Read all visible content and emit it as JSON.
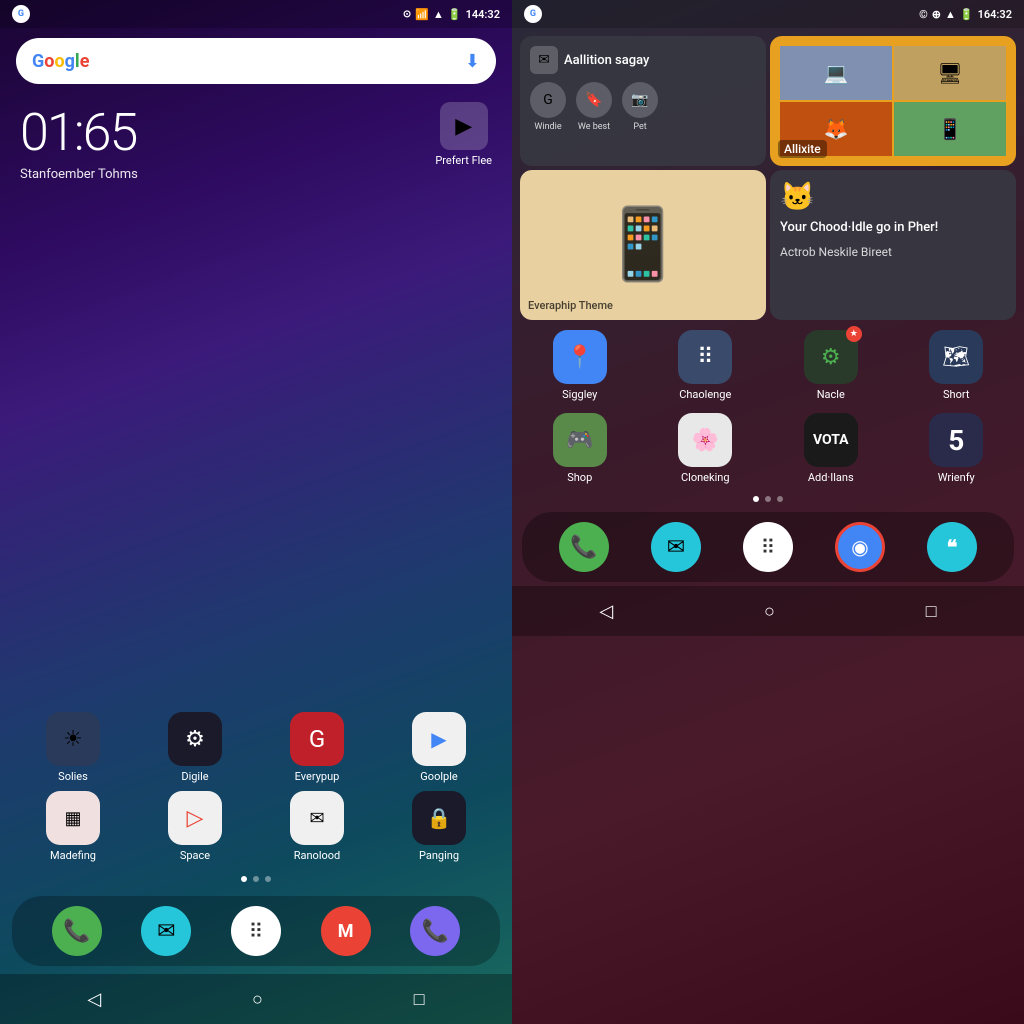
{
  "left": {
    "statusBar": {
      "time": "144:32",
      "gIcon": "G"
    },
    "searchBar": {
      "googleText": "Google",
      "micIcon": "⬇"
    },
    "clock": {
      "time": "01:65",
      "date": "Stanfoember Tohms"
    },
    "playStore": {
      "label": "Prefert Flee"
    },
    "apps": [
      {
        "name": "Solies",
        "icon": "☀",
        "bg": "#2a3a5a"
      },
      {
        "name": "Digile",
        "icon": "⚙",
        "bg": "#1a1a2a"
      },
      {
        "name": "Everypup",
        "icon": "G",
        "bg": "#c0202a"
      },
      {
        "name": "Goolple",
        "icon": "▶",
        "bg": "#f0f0f0"
      },
      {
        "name": "Madefing",
        "icon": "▦",
        "bg": "#f0e0e0"
      },
      {
        "name": "Space",
        "icon": "▷",
        "bg": "#f0f0f0"
      },
      {
        "name": "Ranolood",
        "icon": "✉",
        "bg": "#f0f0f0"
      },
      {
        "name": "Panging",
        "icon": "🔒",
        "bg": "#1a1a2a"
      }
    ],
    "dock": [
      {
        "icon": "📞",
        "bg": "#4CAF50",
        "name": "phone"
      },
      {
        "icon": "✉",
        "bg": "#26C6DA",
        "name": "email"
      },
      {
        "icon": "⠿",
        "bg": "white",
        "name": "apps"
      },
      {
        "icon": "M",
        "bg": "#EA4335",
        "name": "gmail"
      },
      {
        "icon": "📞",
        "bg": "#7B68EE",
        "name": "dialer2"
      }
    ],
    "navBar": {
      "back": "◁",
      "home": "○",
      "recent": "□"
    }
  },
  "right": {
    "statusBar": {
      "time": "164:32",
      "gIcon": "G"
    },
    "widgets": {
      "topLeft": {
        "icon": "✉",
        "title": "Aallition sagay",
        "actions": [
          {
            "icon": "G",
            "label": "Windie"
          },
          {
            "icon": "🔖",
            "label": "We best"
          },
          {
            "icon": "📷",
            "label": "Pet"
          }
        ]
      },
      "topRight": {
        "label": "Allixite"
      },
      "bottomLeft": {
        "label": "Everaphip Theme"
      },
      "bottomRight": {
        "title": "Your Chood·Idle go in Pher!",
        "subtitle": "Actrob Neskile Bireet"
      }
    },
    "apps": [
      {
        "name": "Siggley",
        "icon": "📍",
        "bg": "#4285F4"
      },
      {
        "name": "Chaolenge",
        "icon": "⠿",
        "bg": "#3a4a6a"
      },
      {
        "name": "Nacle",
        "icon": "⚙",
        "bg": "#2a3a2a",
        "badge": true
      },
      {
        "name": "Short",
        "icon": "🗺",
        "bg": "#2a3a5a"
      },
      {
        "name": "Shop",
        "icon": "🎮",
        "bg": "#5a8a4a"
      },
      {
        "name": "Cloneking",
        "icon": "🌸",
        "bg": "#e8e8e8"
      },
      {
        "name": "Add·Ilans",
        "icon": "VOTA",
        "bg": "#1a1a1a"
      },
      {
        "name": "Wrienfy",
        "icon": "5",
        "bg": "#2a2a4a"
      }
    ],
    "dock": [
      {
        "icon": "📞",
        "bg": "#4CAF50",
        "name": "phone"
      },
      {
        "icon": "✉",
        "bg": "#26C6DA",
        "name": "email"
      },
      {
        "icon": "⠿",
        "bg": "white",
        "name": "apps"
      },
      {
        "icon": "◉",
        "bg": "#4285F4",
        "name": "chrome"
      },
      {
        "icon": "❝",
        "bg": "#26C6DA",
        "name": "messages"
      }
    ],
    "navBar": {
      "back": "◁",
      "home": "○",
      "recent": "□"
    }
  }
}
